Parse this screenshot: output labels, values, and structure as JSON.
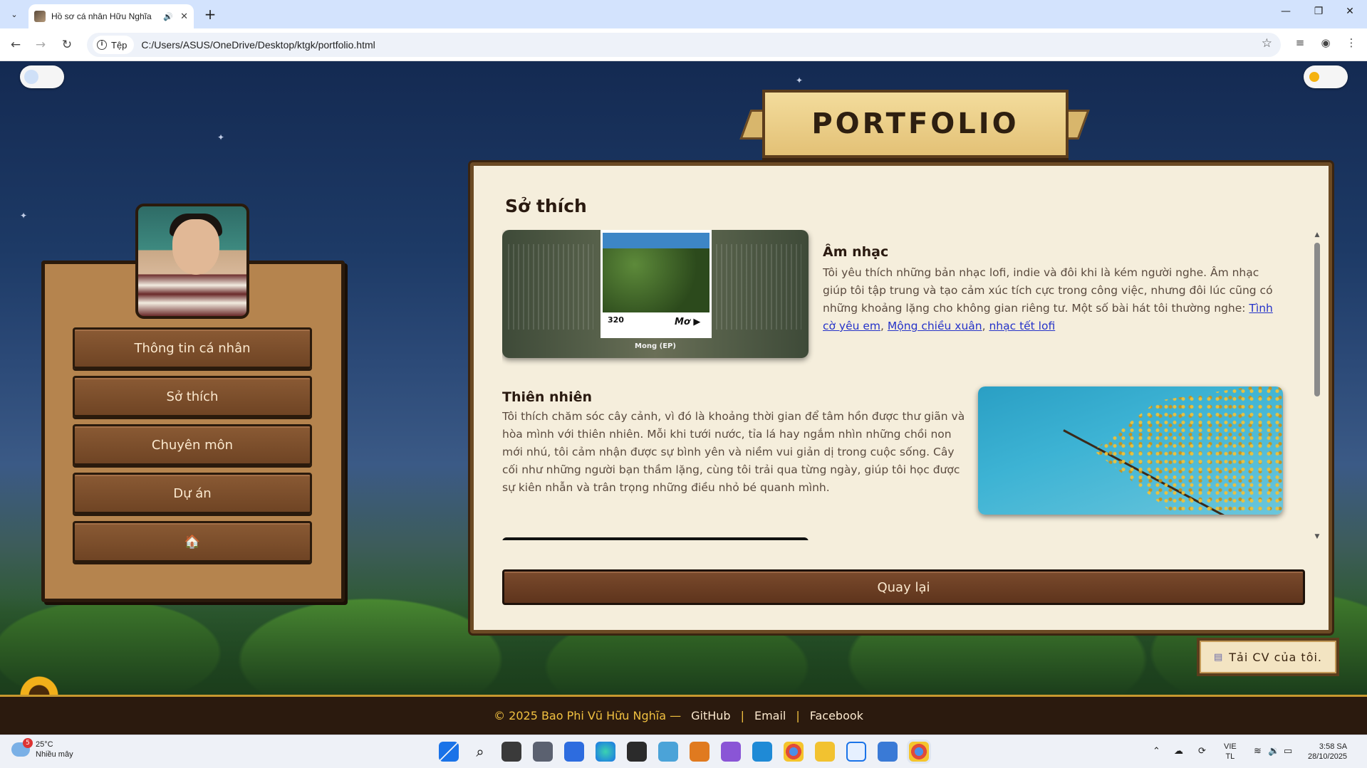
{
  "browser": {
    "tab_title": "Hồ sơ cá nhân Hữu Nghĩa",
    "site_chip": "Tệp",
    "url": "C:/Users/ASUS/OneDrive/Desktop/ktgk/portfolio.html",
    "icons": [
      "tab-list-icon",
      "speaker-icon",
      "close-icon",
      "plus-icon",
      "minimize-icon",
      "restore-icon",
      "close-window-icon",
      "back-icon",
      "forward-icon",
      "reload-icon",
      "info-icon",
      "star-icon",
      "media-icon",
      "profile-icon",
      "menu-icon"
    ]
  },
  "page": {
    "banner_title": "PORTFOLIO",
    "sidebar": {
      "items": [
        {
          "label": "Thông tin cá nhân"
        },
        {
          "label": "Sở thích"
        },
        {
          "label": "Chuyên môn"
        },
        {
          "label": "Dự án"
        },
        {
          "label": "🏠"
        }
      ]
    },
    "section": {
      "title": "Sở thích",
      "music": {
        "heading": "Âm nhạc",
        "text": "Tôi yêu thích những bản nhạc lofi, indie và đôi khi là kém người nghe. Âm nhạc giúp tôi tập trung và tạo cảm xúc tích cực trong công việc, nhưng đôi lúc cũng có những khoảng lặng cho không gian riêng tư. Một số bài hát tôi thường nghe: ",
        "links": [
          "Tình cờ yêu em",
          "Mộng chiều xuân",
          "nhạc tết lofi"
        ],
        "album_badge": "320",
        "album_play": "Mơ",
        "album_caption": "Mong (EP)"
      },
      "nature": {
        "heading": "Thiên nhiên",
        "text": "Tôi thích chăm sóc cây cảnh, vì đó là khoảng thời gian để tâm hồn được thư giãn và hòa mình với thiên nhiên. Mỗi khi tưới nước, tỉa lá hay ngắm nhìn những chồi non mới nhú, tôi cảm nhận được sự bình yên và niềm vui giản dị trong cuộc sống. Cây cối như những người bạn thầm lặng, cùng tôi trải qua từng ngày, giúp tôi học được sự kiên nhẫn và trân trọng những điều nhỏ bé quanh mình."
      },
      "back_label": "Quay lại"
    },
    "cv_button": "Tải CV của tôi.",
    "footer": {
      "copyright": "© 2025 Bao Phi Vũ Hữu Nghĩa —",
      "links": [
        "GitHub",
        "Email",
        "Facebook"
      ],
      "separator": "|"
    }
  },
  "taskbar": {
    "weather_temp": "25°C",
    "weather_desc": "Nhiều mây",
    "weather_badge": "5",
    "lang_1": "VIE",
    "lang_2": "TL",
    "time": "3:58 SA",
    "date": "28/10/2025"
  },
  "colors": {
    "tabbar": "#d3e3fd",
    "panel_wood": "#b5844e",
    "button_brown": "#6f4424",
    "content_bg": "#f5eedc",
    "footer_bg": "#2b1a0e",
    "footer_accent": "#f0c040",
    "link": "#2533c9"
  }
}
